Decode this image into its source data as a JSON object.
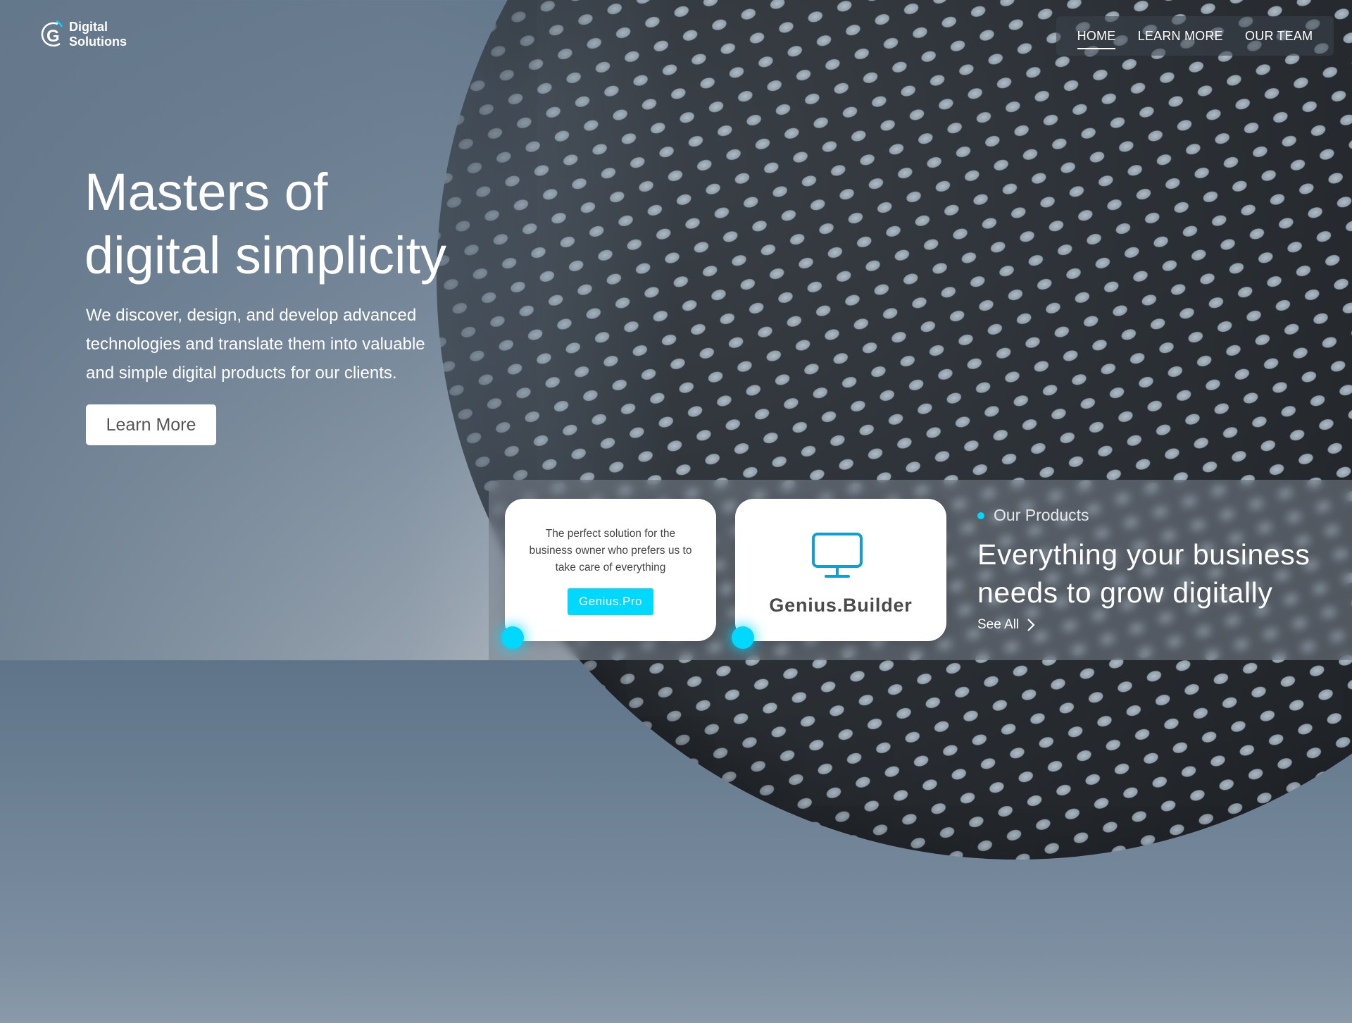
{
  "brand": {
    "line1": "Digital",
    "line2": "Solutions",
    "mark_letter": "G"
  },
  "nav": {
    "items": [
      {
        "label": "HOME",
        "active": true
      },
      {
        "label": "LEARN MORE"
      },
      {
        "label": "OUR TEAM"
      }
    ]
  },
  "hero": {
    "title_line1": "Masters of",
    "title_line2": "digital simplicity",
    "subtitle_line1": "We discover, design, and develop advanced",
    "subtitle_line2": "technologies and translate them into valuable",
    "subtitle_line3": "and simple digital products for our clients.",
    "button_label": "Learn More"
  },
  "products": {
    "label": "Our Products",
    "heading_line1": "Everything your business",
    "heading_line2": "needs to grow digitally",
    "see_all": "See All",
    "cards": [
      {
        "desc_line1": "The perfect solution for the",
        "desc_line2": "business owner who prefers us to",
        "desc_line3": "take care of everything",
        "button_label": "Genius.Pro"
      },
      {
        "title": "Genius.Builder",
        "icon": "monitor-icon"
      }
    ]
  },
  "colors": {
    "accent": "#00d8ff",
    "icon_blue": "#0e9fd6",
    "white": "#ffffff"
  }
}
